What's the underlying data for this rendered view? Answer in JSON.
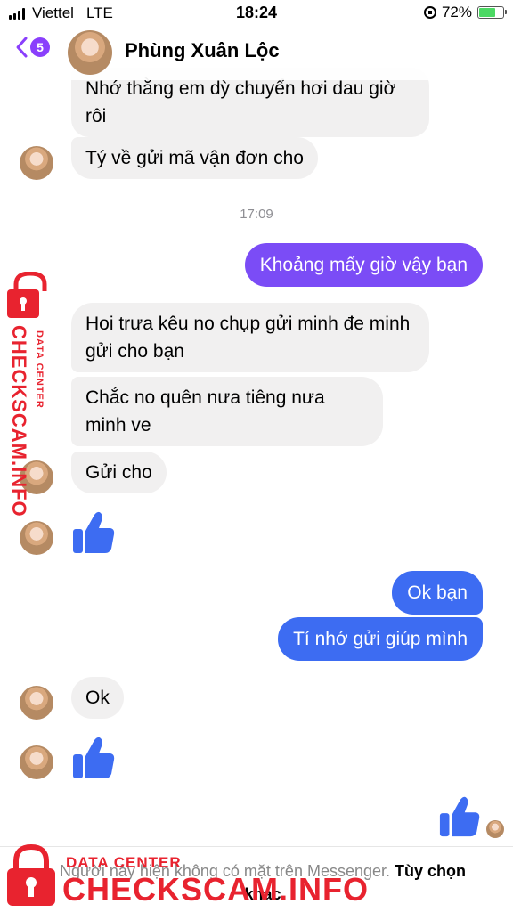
{
  "status_bar": {
    "carrier": "Viettel",
    "network": "LTE",
    "time": "18:24",
    "battery": "72%",
    "battery_level": 0.72,
    "battery_color": "#4cd964"
  },
  "header": {
    "back_icon": "chevron-left-icon",
    "unread_badge": "5",
    "contact_name": "Phùng Xuân Lộc",
    "accent_color": "#8a3ffc"
  },
  "messages": {
    "m1": "Nhớ thằng em dỳ chuyển hơi dau giờ rôi",
    "m2": "Tý về gửi mã vận đơn cho",
    "time_separator": "17:09",
    "m3": "Khoảng mấy giờ vậy bạn",
    "m4": "Hoi trưa kêu no chụp gửi minh đe minh gửi cho bạn",
    "m5": "Chắc no quên nưa tiêng nưa minh ve",
    "m6": "Gửi cho",
    "m7": "Ok bạn",
    "m8": "Tí nhớ gửi giúp mình",
    "m9": "Ok",
    "like_icon": "thumbs-up-icon",
    "colors": {
      "incoming": "#f1f0f0",
      "outgoing_purple": "#7b4cf6",
      "outgoing_blue": "#3d6cf2",
      "like": "#3d6cf2"
    }
  },
  "footer": {
    "notice": "Người này hiện không có mặt trên Messenger.",
    "link": "Tùy chọn khác"
  },
  "watermark": {
    "small": "DATA CENTER",
    "big": "CHECKSCAM.INFO",
    "color": "#e8232f",
    "icon": "padlock-icon"
  }
}
